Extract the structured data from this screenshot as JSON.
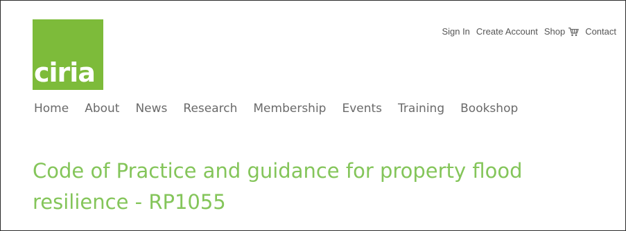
{
  "logo": {
    "text": "ciria",
    "color": "#7dbb3a"
  },
  "utility_nav": {
    "sign_in": "Sign In",
    "create_account": "Create Account",
    "shop": "Shop",
    "shop_icon": "shopping-cart-icon",
    "contact": "Contact"
  },
  "main_nav": {
    "items": [
      {
        "label": "Home"
      },
      {
        "label": "About"
      },
      {
        "label": "News"
      },
      {
        "label": "Research"
      },
      {
        "label": "Membership"
      },
      {
        "label": "Events"
      },
      {
        "label": "Training"
      },
      {
        "label": "Bookshop"
      }
    ]
  },
  "page": {
    "title": "Code of Practice and guidance for property flood resilience - RP1055",
    "title_color": "#84c55a"
  }
}
